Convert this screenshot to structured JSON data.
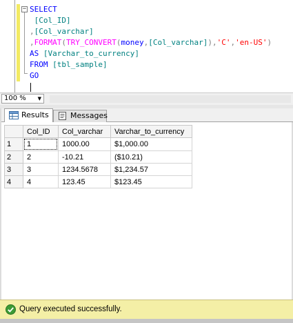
{
  "editor": {
    "lines": [
      [
        {
          "t": "SELECT",
          "c": "kw"
        }
      ],
      [
        {
          "t": " [Col_ID]",
          "c": "tl"
        }
      ],
      [
        {
          "t": ",",
          "c": "gr"
        },
        {
          "t": "[Col_varchar]",
          "c": "tl"
        }
      ],
      [
        {
          "t": ",",
          "c": "gr"
        },
        {
          "t": "FORMAT",
          "c": "fn"
        },
        {
          "t": "(",
          "c": "gr"
        },
        {
          "t": "TRY_CONVERT",
          "c": "fn"
        },
        {
          "t": "(",
          "c": "gr"
        },
        {
          "t": "money",
          "c": "kw"
        },
        {
          "t": ",",
          "c": "gr"
        },
        {
          "t": "[Col_varchar]",
          "c": "tl"
        },
        {
          "t": "),",
          "c": "gr"
        },
        {
          "t": "'C'",
          "c": "st"
        },
        {
          "t": ",",
          "c": "gr"
        },
        {
          "t": "'en-US'",
          "c": "st"
        },
        {
          "t": ")",
          "c": "gr"
        }
      ],
      [
        {
          "t": "AS ",
          "c": "kw"
        },
        {
          "t": "[Varchar_to_currency]",
          "c": "tl"
        }
      ],
      [
        {
          "t": "FROM ",
          "c": "kw"
        },
        {
          "t": "[tbl_sample]",
          "c": "tl"
        }
      ],
      [
        {
          "t": "GO",
          "c": "kw"
        }
      ]
    ]
  },
  "zoom": {
    "value": "100 %"
  },
  "tabs": {
    "results_label": "Results",
    "messages_label": "Messages"
  },
  "grid": {
    "columns": [
      "Col_ID",
      "Col_varchar",
      "Varchar_to_currency"
    ],
    "rows": [
      {
        "num": "1",
        "cells": [
          "1",
          "1000.00",
          "$1,000.00"
        ]
      },
      {
        "num": "2",
        "cells": [
          "2",
          "-10.21",
          "($10.21)"
        ]
      },
      {
        "num": "3",
        "cells": [
          "3",
          "1234.5678",
          "$1,234.57"
        ]
      },
      {
        "num": "4",
        "cells": [
          "4",
          "123.45",
          "$123.45"
        ]
      }
    ]
  },
  "status": {
    "text": "Query executed successfully."
  },
  "colors": {
    "status_bg": "#f4efa6",
    "keyword": "#0000ff",
    "function": "#ff00ff",
    "string": "#ff0000",
    "identifier": "#008080"
  }
}
